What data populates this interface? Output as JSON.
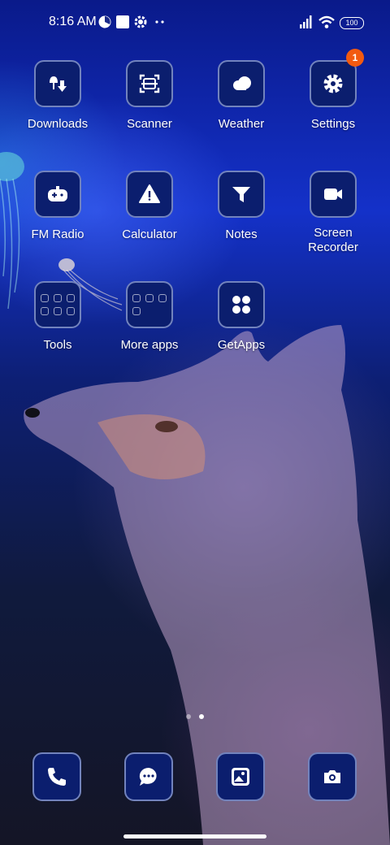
{
  "status_bar": {
    "time": "8:16 AM",
    "battery": "100",
    "icons": [
      "pie-indicator-icon",
      "square-notification-icon",
      "gear-icon",
      "more-dots-icon",
      "signal-icon",
      "wifi-icon",
      "battery-icon"
    ]
  },
  "apps": [
    {
      "label": "Downloads",
      "icon": "downloads-icon"
    },
    {
      "label": "Scanner",
      "icon": "scanner-icon"
    },
    {
      "label": "Weather",
      "icon": "weather-icon"
    },
    {
      "label": "Settings",
      "icon": "gear-icon",
      "badge": "1"
    },
    {
      "label": "FM Radio",
      "icon": "radio-icon"
    },
    {
      "label": "Calculator",
      "icon": "calculator-icon"
    },
    {
      "label": "Notes",
      "icon": "notes-icon"
    },
    {
      "label": "Screen\nRecorder",
      "icon": "video-icon"
    },
    {
      "label": "Tools",
      "icon": "folder-icon"
    },
    {
      "label": "More apps",
      "icon": "folder-icon"
    },
    {
      "label": "GetApps",
      "icon": "getapps-icon"
    }
  ],
  "dock": [
    {
      "icon": "phone-icon"
    },
    {
      "icon": "messages-icon"
    },
    {
      "icon": "gallery-icon"
    },
    {
      "icon": "camera-icon"
    }
  ],
  "pages": {
    "count": 2,
    "active": 2
  },
  "colors": {
    "tile_bg": "#0b1e6e",
    "badge": "#f25a10"
  }
}
